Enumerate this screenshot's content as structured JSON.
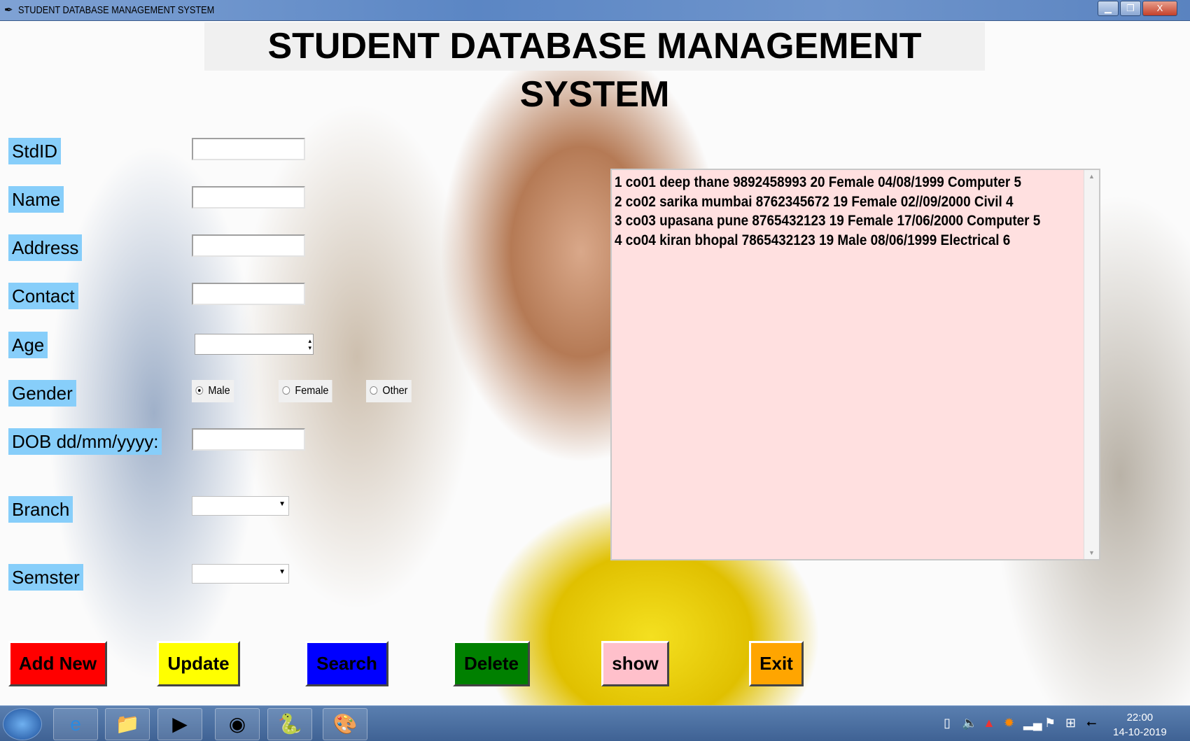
{
  "window": {
    "title": "STUDENT DATABASE MANAGEMENT SYSTEM",
    "minimize": "▁",
    "restore": "❐",
    "close": "X"
  },
  "header": "STUDENT DATABASE MANAGEMENT SYSTEM",
  "form": {
    "stdid_label": "StdID",
    "name_label": "Name",
    "address_label": "Address",
    "contact_label": "Contact",
    "age_label": "Age",
    "gender_label": "Gender",
    "dob_label": "DOB dd/mm/yyyy:",
    "branch_label": "Branch",
    "semester_label": "Semster",
    "stdid": "",
    "name": "",
    "address": "",
    "contact": "",
    "age": "",
    "dob": "",
    "branch": "",
    "semester": "",
    "gender_options": [
      "Male",
      "Female",
      "Other"
    ],
    "gender_selected": "Male"
  },
  "records": [
    "1 co01 deep thane 9892458993 20 Female 04/08/1999 Computer 5",
    "2 co02 sarika mumbai 8762345672 19 Female 02//09/2000 Civil 4",
    "3 co03 upasana pune 8765432123 19 Female 17/06/2000 Computer 5",
    "4 co04 kiran bhopal 7865432123 19 Male 08/06/1999 Electrical 6"
  ],
  "buttons": {
    "add": "Add New",
    "update": "Update",
    "search": "Search",
    "delete": "Delete",
    "show": "show",
    "exit": "Exit"
  },
  "colors": {
    "add": "#ff0000",
    "update": "#ffff00",
    "search": "#0000ff",
    "delete": "#008000",
    "show": "#ffc0cb",
    "exit": "#ffa500",
    "label_bg": "#87cefa",
    "list_bg": "#ffe0e0"
  },
  "taskbar": {
    "time": "22:00",
    "date": "14-10-2019"
  }
}
